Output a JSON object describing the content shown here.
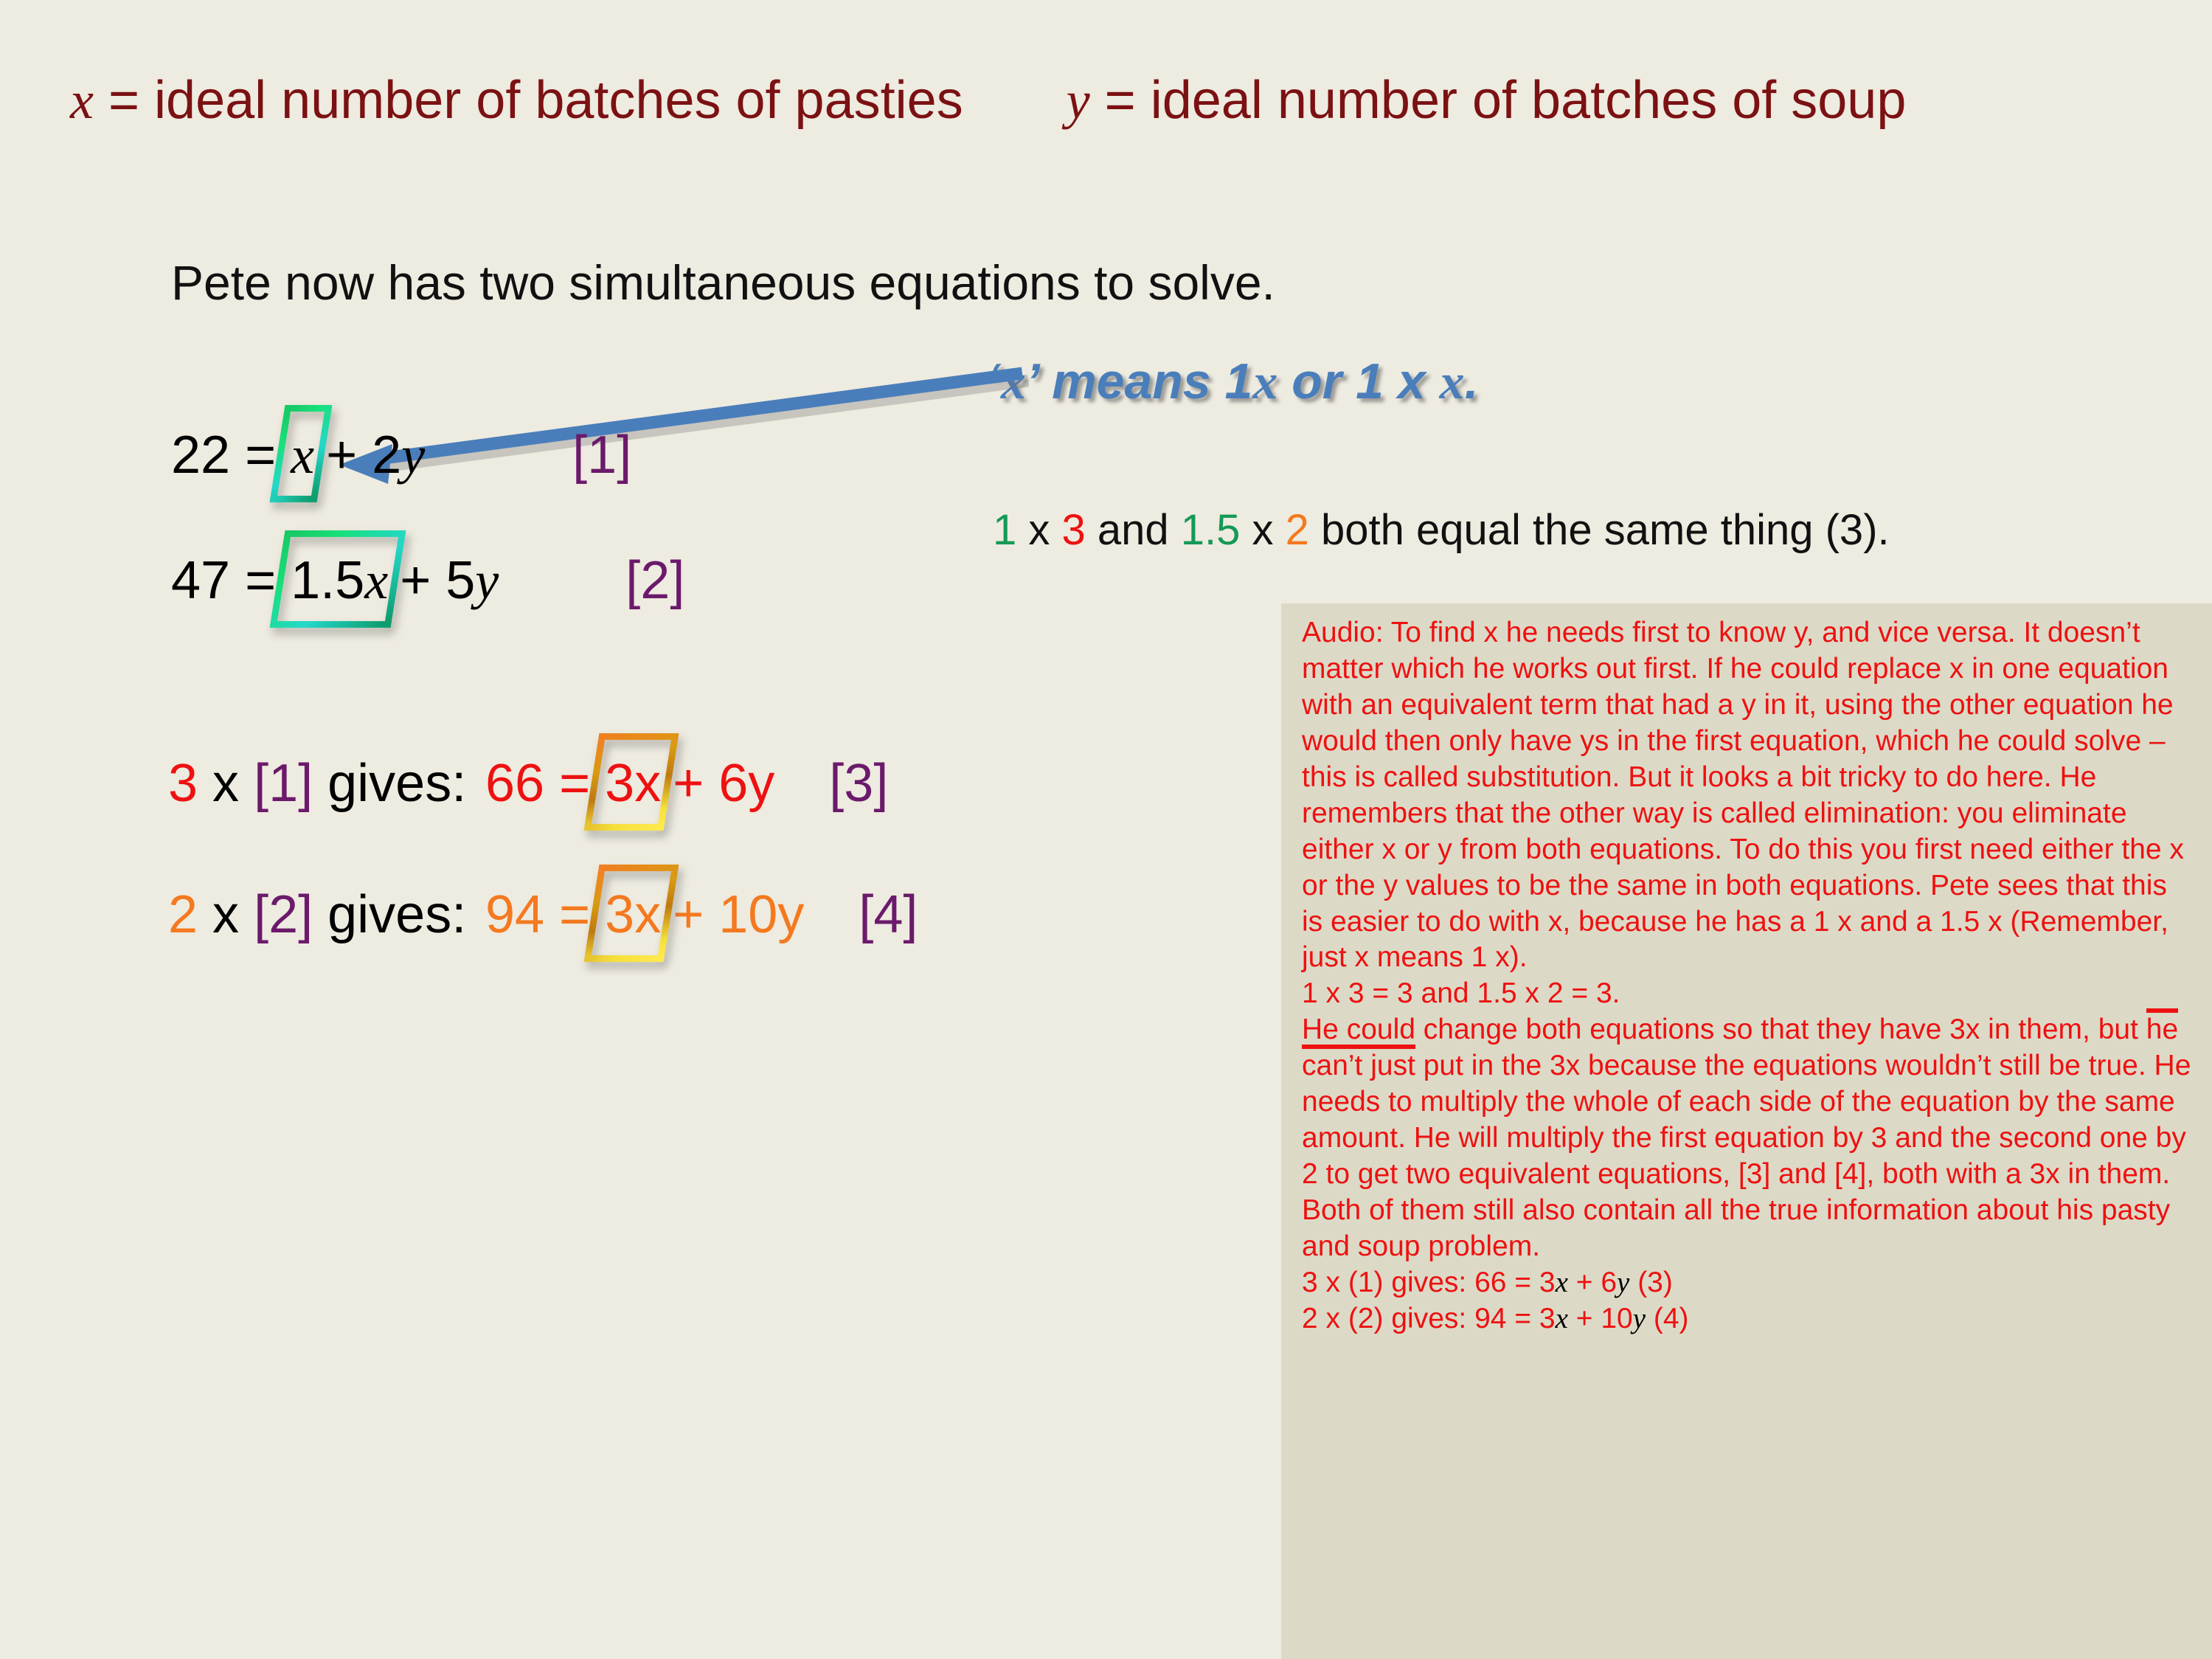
{
  "slide": {
    "background_color": "#eeebe0",
    "definitions": {
      "x_var": "x",
      "x_text": " = ideal number of batches of pasties",
      "y_var": "y",
      "y_text": " = ideal number of batches of soup",
      "color": "#7b1113"
    },
    "intro": "Pete now has two simultaneous equations to solve.",
    "callout": {
      "open_quote": "‘",
      "var": "x",
      "close_quote": "’",
      "text_a": " means 1",
      "var2": "x",
      "text_b": " or 1 x ",
      "var3": "x",
      "text_c": ".",
      "color": "#4a7ebb"
    },
    "equations": [
      {
        "id": "eq-1",
        "lhs": "22 =",
        "boxed": "x",
        "boxed_kind": "green",
        "rhs_coef": "+ 2",
        "rhs_var": "y",
        "tag": "[1]",
        "tag_color": "#6b1a6b",
        "text_color": "#111111"
      },
      {
        "id": "eq-2",
        "lhs": "47 =",
        "boxed_num": "1.5",
        "boxed_var": "x",
        "boxed_kind": "green",
        "rhs_coef": "+ 5",
        "rhs_var": "y",
        "tag": "[2]",
        "tag_color": "#6b1a6b",
        "text_color": "#111111"
      }
    ],
    "same_thing_line": {
      "n1": "1",
      "t1": " x ",
      "n2": "3",
      "t2": " and ",
      "n3": "1.5",
      "t3": " x ",
      "n4": "2",
      "t4": " both equal the same thing (3)."
    },
    "steps": [
      {
        "id": "step-3",
        "multiplier": "3",
        "mult_sign": " x ",
        "ref": "[1]",
        "gives": " gives:",
        "result_lhs": "66 =",
        "boxed_num": "3",
        "boxed_var": "x",
        "boxed_kind": "gold",
        "rhs_coef": "+ 6",
        "rhs_var": "y",
        "tag": "[3]",
        "color": "#ee1111"
      },
      {
        "id": "step-4",
        "multiplier": "2",
        "mult_sign": " x ",
        "ref": "[2]",
        "gives": " gives:",
        "result_lhs": "94 =",
        "boxed_num": "3",
        "boxed_var": "x",
        "boxed_kind": "gold",
        "rhs_coef": "+ 10",
        "rhs_var": "y",
        "tag": "[4]",
        "color": "#f4791f"
      }
    ],
    "arrow": {
      "color": "#4a7ebb",
      "description": "arrow-from-callout-to-x-box"
    }
  },
  "audio_panel": {
    "background_color": "#dcdac7",
    "text_color": "#ee1111",
    "label": "Audio:",
    "body_part_1": " To find x he needs first to know y, and vice versa. It doesn’t matter which he works out first. If he could replace x in one equation with an equivalent term that had a y in it, using the other equation he would then only have ys in the first equation, which he could solve – this is called substitution. But it looks a bit tricky to do here. He remembers that the other way is called elimination: you eliminate either x or y from both equations. To do this you first need either the x or the y values to be the same in both equations. Pete sees that this is easier to do with x, because he has a 1 x and a 1.5 x (Remember, just x means 1 x).",
    "line_equals": "1 x 3 = 3 and 1.5 x 2 = 3.",
    "body_part_2a": "He could change both equations so that they have 3x in them, but ",
    "body_part_2b": "he can’t just",
    "body_part_2c": " put in the 3x because the equations wouldn’t still be true. He needs to multiply the whole of each side of the equation by the same amount. He will multiply the first equation by 3 and the second one by 2 to get two equivalent equations, [3] and [4], both with a 3x in them. Both of them still also contain all the true information about his pasty and soup problem.",
    "eq3_pre": "3 x (1) gives: 66 = 3",
    "eq3_x": "x",
    "eq3_mid": " + 6",
    "eq3_y": "y",
    "eq3_post": "  (3)",
    "eq4_pre": "2 x (2) gives: 94 = 3",
    "eq4_x": "x",
    "eq4_mid": " + 10",
    "eq4_y": "y",
    "eq4_post": "  (4)"
  }
}
